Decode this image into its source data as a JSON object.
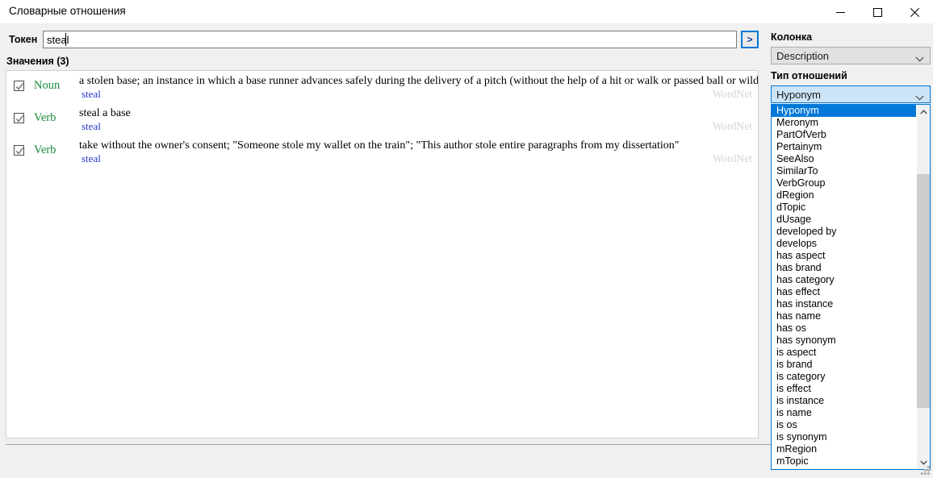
{
  "window": {
    "title": "Словарные отношения",
    "minimize_label": "Свернуть",
    "maximize_label": "Развернуть",
    "close_label": "Закрыть"
  },
  "search": {
    "token_label": "Токен",
    "token_value": "steal",
    "token_placeholder": "",
    "go_label": ">"
  },
  "values": {
    "header": "Значения (3)",
    "rows": [
      {
        "checked": true,
        "pos": "Noun",
        "definition": "a stolen base; an instance in which a base runner advances safely during the delivery of a pitch (without the help of a hit or walk or passed ball or wild pitch)",
        "lemma": "steal",
        "source": "WordNet"
      },
      {
        "checked": true,
        "pos": "Verb",
        "definition": "steal a base",
        "lemma": "steal",
        "source": "WordNet"
      },
      {
        "checked": true,
        "pos": "Verb",
        "definition": "take without the owner's consent; \"Someone stole my wallet on the train\"; \"This author stole entire paragraphs from my dissertation\"",
        "lemma": "steal",
        "source": "WordNet"
      }
    ]
  },
  "sidebar": {
    "column_label": "Колонка",
    "column_value": "Description",
    "reltype_label": "Тип отношений",
    "reltype_value": "Hyponym",
    "reltype_options": [
      "Hyponym",
      "Meronym",
      "PartOfVerb",
      "Pertainym",
      "SeeAlso",
      "SimilarTo",
      "VerbGroup",
      "dRegion",
      "dTopic",
      "dUsage",
      "developed by",
      "develops",
      "has aspect",
      "has brand",
      "has category",
      "has effect",
      "has instance",
      "has name",
      "has os",
      "has synonym",
      "is aspect",
      "is brand",
      "is category",
      "is effect",
      "is instance",
      "is name",
      "is os",
      "is synonym",
      "mRegion",
      "mTopic"
    ],
    "selected_index": 0
  },
  "colors": {
    "accent": "#0078d7",
    "pos_text": "#178c3c",
    "lemma_link": "#2233cc",
    "source_text": "#d4d4d4",
    "window_bg": "#f0f0f0"
  }
}
